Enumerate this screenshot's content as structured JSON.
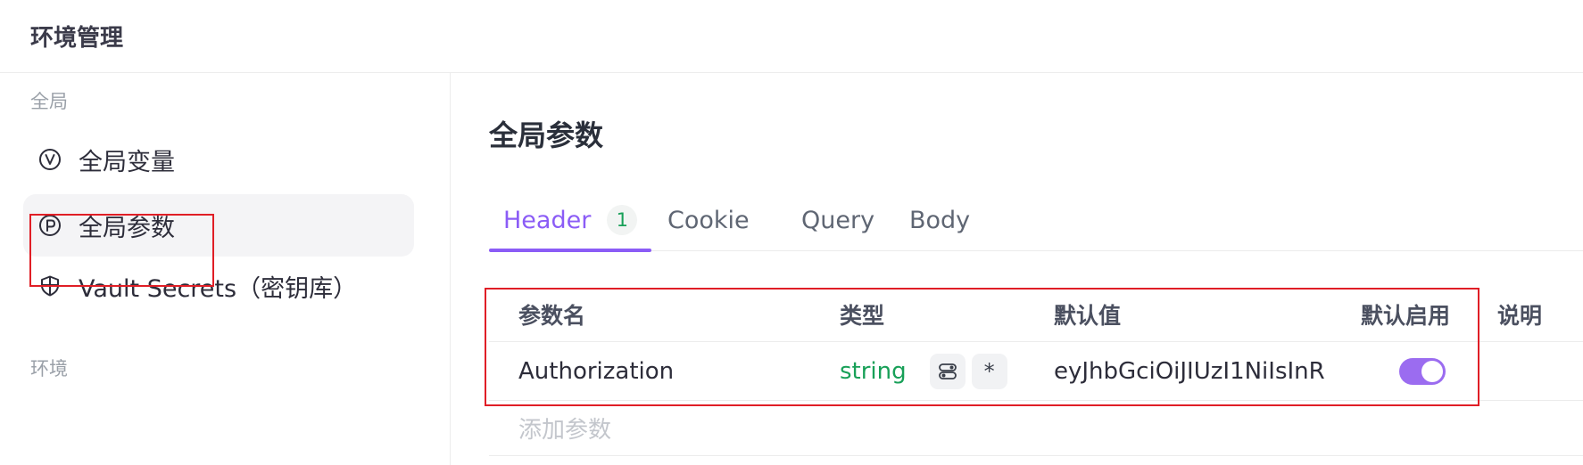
{
  "window": {
    "title": "环境管理"
  },
  "sidebar": {
    "global_section_label": "全局",
    "env_section_label": "环境",
    "items": [
      {
        "label": "全局变量",
        "icon": "variable-v-icon",
        "active": false
      },
      {
        "label": "全局参数",
        "icon": "parameter-p-icon",
        "active": true
      },
      {
        "label": "Vault Secrets（密钥库）",
        "icon": "shield-icon",
        "active": false
      }
    ]
  },
  "main": {
    "title": "全局参数",
    "tabs": [
      {
        "label": "Header",
        "count": "1",
        "active": true
      },
      {
        "label": "Cookie"
      },
      {
        "label": "Query"
      },
      {
        "label": "Body"
      }
    ],
    "table": {
      "headers": {
        "name": "参数名",
        "type": "类型",
        "default_value": "默认值",
        "enabled": "默认启用",
        "description": "说明"
      },
      "rows": [
        {
          "name": "Authorization",
          "type": "string",
          "asterisk": "*",
          "default_value": "eyJhbGciOiJIUzI1NiIsInR",
          "enabled": true,
          "description": ""
        }
      ],
      "add_placeholder": "添加参数"
    }
  },
  "colors": {
    "accent": "#8b5cf6",
    "type_green": "#18a058",
    "highlight_red": "#e01e26"
  }
}
